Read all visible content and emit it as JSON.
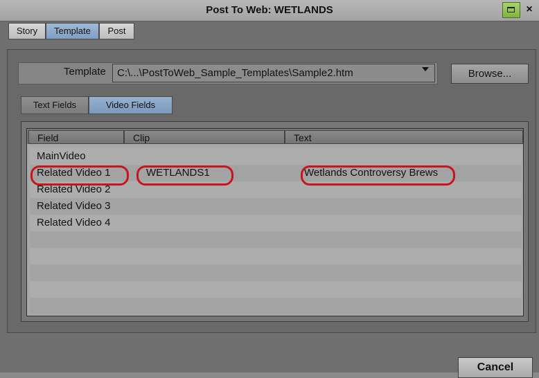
{
  "window": {
    "title": "Post To Web: WETLANDS",
    "maximize_icon": "maximize-icon",
    "close_symbol": "×"
  },
  "top_tabs": [
    {
      "label": "Story",
      "active": false
    },
    {
      "label": "Template",
      "active": true
    },
    {
      "label": "Post",
      "active": false
    }
  ],
  "template": {
    "label": "Template",
    "value": "C:\\...\\PostToWeb_Sample_Templates\\Sample2.htm",
    "browse_label": "Browse..."
  },
  "sub_tabs": [
    {
      "label": "Text Fields",
      "active": false
    },
    {
      "label": "Video Fields",
      "active": true
    }
  ],
  "table": {
    "columns": [
      "Field",
      "Clip",
      "Text"
    ],
    "rows": [
      {
        "field": "MainVideo",
        "clip": "",
        "text": ""
      },
      {
        "field": "Related Video 1",
        "clip": "WETLANDS1",
        "text": "Wetlands Controversy Brews"
      },
      {
        "field": "Related Video 2",
        "clip": "",
        "text": ""
      },
      {
        "field": "Related Video 3",
        "clip": "",
        "text": ""
      },
      {
        "field": "Related Video 4",
        "clip": "",
        "text": ""
      },
      {
        "field": "",
        "clip": "",
        "text": ""
      },
      {
        "field": "",
        "clip": "",
        "text": ""
      },
      {
        "field": "",
        "clip": "",
        "text": ""
      },
      {
        "field": "",
        "clip": "",
        "text": ""
      },
      {
        "field": "",
        "clip": "",
        "text": ""
      }
    ]
  },
  "highlight_color": "#c8141c",
  "cancel_label": "Cancel"
}
